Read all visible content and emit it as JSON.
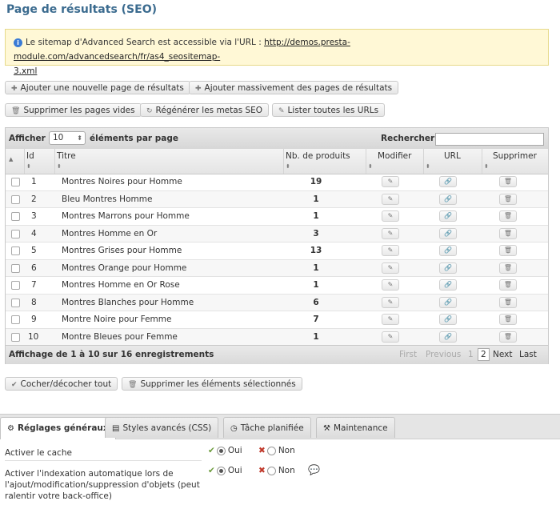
{
  "page": {
    "title": "Page de résultats (SEO)"
  },
  "notice": {
    "text": "Le sitemap d'Advanced Search est accessible via l'URL : ",
    "link": "http://demos.presta-module.com/advancedsearch/fr/as4_seositemap-",
    "link2": "3.xml",
    "icon": "info-icon"
  },
  "actions": {
    "add_page": "Ajouter une nouvelle page de résultats",
    "add_bulk": "Ajouter massivement des pages de résultats",
    "delete_empty": "Supprimer les pages vides",
    "regen_metas": "Régénérer les metas SEO",
    "list_urls": "Lister toutes les URLs"
  },
  "grid": {
    "show_label": "Afficher",
    "page_size": "10",
    "per_page_label": "éléments par page",
    "search_label": "Rechercher",
    "search_value": "",
    "columns": {
      "id": "Id",
      "title": "Titre",
      "products": "Nb. de produits",
      "edit": "Modifier",
      "url": "URL",
      "delete": "Supprimer"
    },
    "rows": [
      {
        "id": "1",
        "title": "Montres Noires pour Homme",
        "products": "19"
      },
      {
        "id": "2",
        "title": "Bleu Montres Homme",
        "products": "1"
      },
      {
        "id": "3",
        "title": "Montres Marrons pour Homme",
        "products": "1"
      },
      {
        "id": "4",
        "title": "Montres Homme en Or",
        "products": "3"
      },
      {
        "id": "5",
        "title": "Montres Grises pour Homme",
        "products": "13"
      },
      {
        "id": "6",
        "title": "Montres Orange pour Homme",
        "products": "1"
      },
      {
        "id": "7",
        "title": "Montres Homme en Or Rose",
        "products": "1"
      },
      {
        "id": "8",
        "title": "Montres Blanches pour Homme",
        "products": "6"
      },
      {
        "id": "9",
        "title": "Montre Noire pour Femme",
        "products": "7"
      },
      {
        "id": "10",
        "title": "Montre Bleues pour Femme",
        "products": "1"
      }
    ],
    "info": "Affichage de 1 à 10 sur 16 enregistrements",
    "pagination": {
      "first": "First",
      "previous": "Previous",
      "p1": "1",
      "p2": "2",
      "next": "Next",
      "last": "Last"
    }
  },
  "bulk": {
    "toggle_all": "Cocher/décocher tout",
    "delete_selected": "Supprimer les éléments sélectionnés"
  },
  "tabs": [
    {
      "label": "Réglages généraux"
    },
    {
      "label": "Styles avancés (CSS)"
    },
    {
      "label": "Tâche planifiée"
    },
    {
      "label": "Maintenance"
    }
  ],
  "settings": {
    "cache_label": "Activer le cache",
    "index_label_1": "Activer l'indexation automatique lors de",
    "index_label_2": "l'ajout/modification/suppression d'objets (peut",
    "index_label_3": "ralentir votre back-office)",
    "yes": "Oui",
    "no": "Non"
  }
}
